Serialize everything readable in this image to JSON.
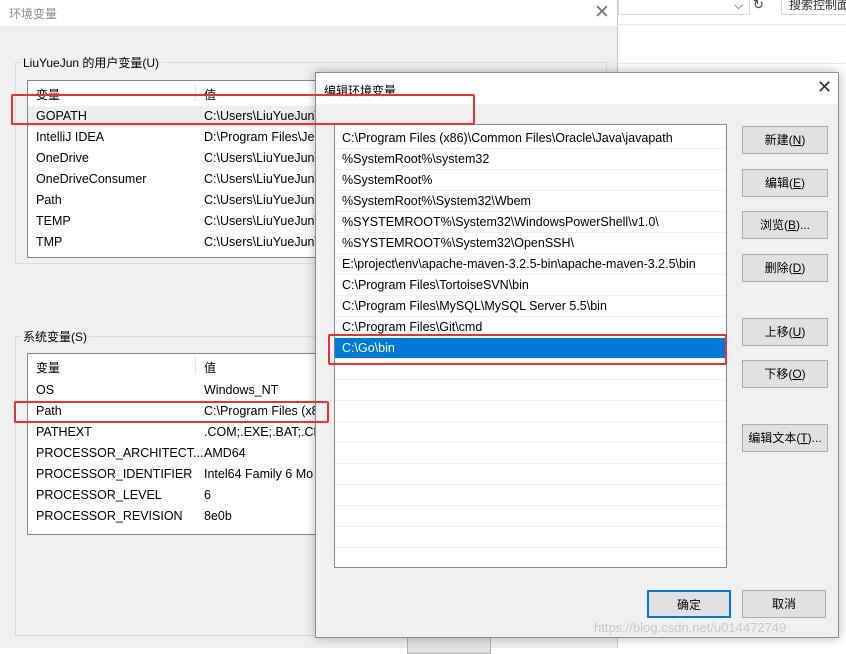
{
  "background_browser": {
    "chevron": "⌵",
    "refresh_icon": "↻",
    "search_placeholder": "搜索控制面"
  },
  "env_dialog": {
    "title": "环境变量",
    "close_icon": "✕",
    "user_vars": {
      "group_label": "LiuYueJun 的用户变量(U)",
      "col_var": "变量",
      "col_val": "值",
      "rows": [
        {
          "name": "GOPATH",
          "value": "C:\\Users\\LiuYueJun\\"
        },
        {
          "name": "IntelliJ IDEA",
          "value": "D:\\Program Files\\Je"
        },
        {
          "name": "OneDrive",
          "value": "C:\\Users\\LiuYueJun\\"
        },
        {
          "name": "OneDriveConsumer",
          "value": "C:\\Users\\LiuYueJun\\"
        },
        {
          "name": "Path",
          "value": "C:\\Users\\LiuYueJun\\"
        },
        {
          "name": "TEMP",
          "value": "C:\\Users\\LiuYueJun\\"
        },
        {
          "name": "TMP",
          "value": "C:\\Users\\LiuYueJun\\"
        }
      ]
    },
    "system_vars": {
      "group_label": "系统变量(S)",
      "col_var": "变量",
      "col_val": "值",
      "rows": [
        {
          "name": "OS",
          "value": "Windows_NT"
        },
        {
          "name": "Path",
          "value": "C:\\Program Files (x8"
        },
        {
          "name": "PATHEXT",
          "value": ".COM;.EXE;.BAT;.CM"
        },
        {
          "name": "PROCESSOR_ARCHITECT...",
          "value": "AMD64"
        },
        {
          "name": "PROCESSOR_IDENTIFIER",
          "value": "Intel64 Family 6 Mo"
        },
        {
          "name": "PROCESSOR_LEVEL",
          "value": "6"
        },
        {
          "name": "PROCESSOR_REVISION",
          "value": "8e0b"
        }
      ]
    }
  },
  "edit_dialog": {
    "title": "编辑环境变量",
    "close_icon": "✕",
    "paths": [
      "C:\\Program Files (x86)\\Common Files\\Oracle\\Java\\javapath",
      "%SystemRoot%\\system32",
      "%SystemRoot%",
      "%SystemRoot%\\System32\\Wbem",
      "%SYSTEMROOT%\\System32\\WindowsPowerShell\\v1.0\\",
      "%SYSTEMROOT%\\System32\\OpenSSH\\",
      "E:\\project\\env\\apache-maven-3.2.5-bin\\apache-maven-3.2.5\\bin",
      "C:\\Program Files\\TortoiseSVN\\bin",
      "C:\\Program Files\\MySQL\\MySQL Server 5.5\\bin",
      "C:\\Program Files\\Git\\cmd",
      "C:\\Go\\bin"
    ],
    "buttons": {
      "new": {
        "text": "新建(",
        "key": "N",
        "end": ")"
      },
      "edit": {
        "text": "编辑(",
        "key": "E",
        "end": ")"
      },
      "browse": {
        "text": "浏览(",
        "key": "B",
        "end": ")..."
      },
      "delete": {
        "text": "删除(",
        "key": "D",
        "end": ")"
      },
      "move_up": {
        "text": "上移(",
        "key": "U",
        "end": ")"
      },
      "move_down": {
        "text": "下移(",
        "key": "O",
        "end": ")"
      },
      "edit_text": {
        "text": "编辑文本(",
        "key": "T",
        "end": ")..."
      },
      "ok": "确定",
      "cancel": "取消"
    }
  },
  "watermark": "https://blog.csdn.net/u014472749"
}
